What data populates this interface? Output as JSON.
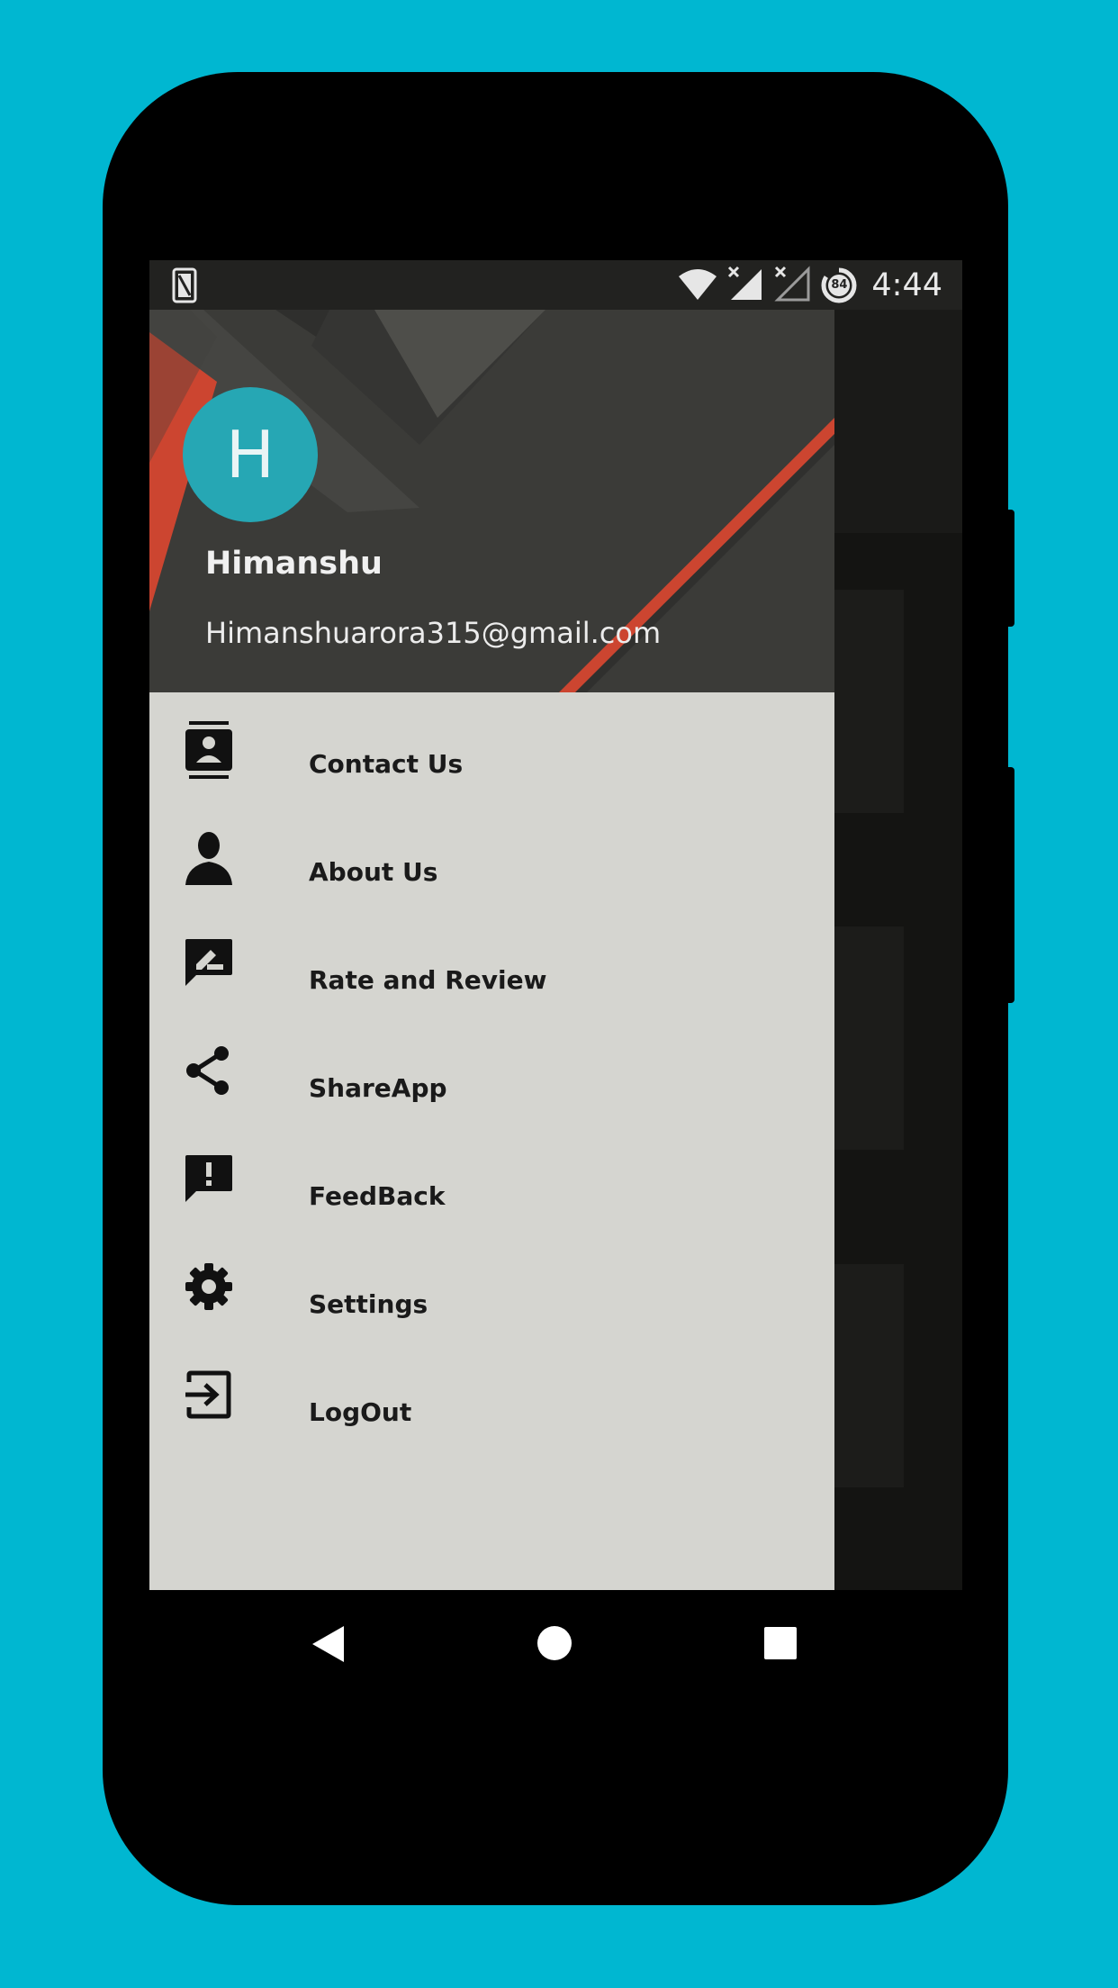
{
  "status_bar": {
    "time": "4:44",
    "battery": "84",
    "icons": [
      "sim-card-icon",
      "wifi-icon",
      "signal-icon",
      "signal-off-icon",
      "battery-icon"
    ]
  },
  "drawer": {
    "avatar_letter": "H",
    "user_name": "Himanshu",
    "user_email": "Himanshuarora315@gmail.com",
    "menu": [
      {
        "label": "Contact Us",
        "icon": "contact-icon"
      },
      {
        "label": "About Us",
        "icon": "person-icon"
      },
      {
        "label": "Rate and Review",
        "icon": "rate-review-icon"
      },
      {
        "label": "ShareApp",
        "icon": "share-icon"
      },
      {
        "label": "FeedBack",
        "icon": "feedback-icon"
      },
      {
        "label": "Settings",
        "icon": "gear-icon"
      },
      {
        "label": "LogOut",
        "icon": "logout-icon"
      }
    ]
  },
  "nav_bar": {
    "icons": [
      "back-icon",
      "home-icon",
      "recents-icon"
    ]
  },
  "colors": {
    "background": "#00b7d1",
    "avatar": "#26a7b4",
    "drawer": "#d5d5d0",
    "header_accent": "#cc4530"
  }
}
